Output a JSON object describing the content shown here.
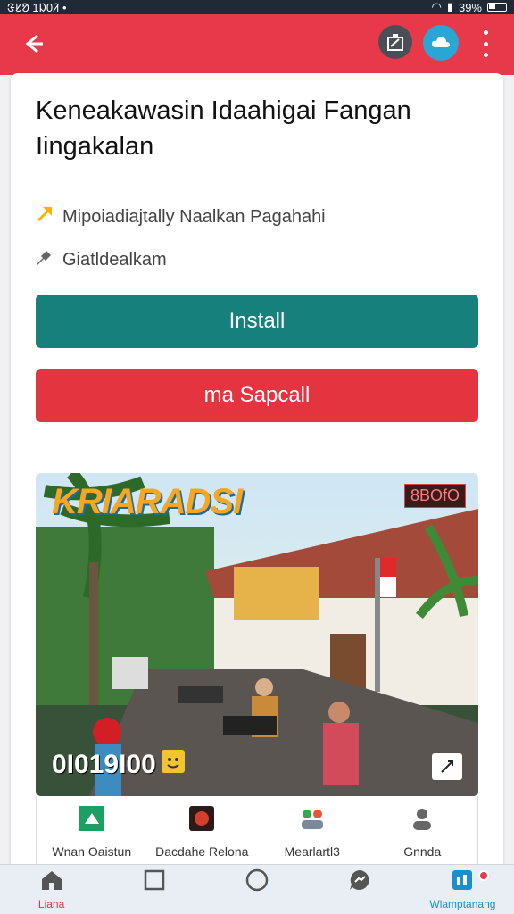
{
  "status_bar": {
    "time": "ᱝᱥᱚ 1ᱡ0ᱤ •",
    "battery": "39%"
  },
  "app_bar": {
    "back_icon": "arrow-left-icon",
    "icons": [
      "share-icon",
      "cloud-icon",
      "more-vertical-icon"
    ]
  },
  "content": {
    "title": "Keneakawasin Idaahigai Fangan Iingakalan",
    "meta1": "Mipoiadiajtally Naalkan Pagahahi",
    "meta2": "Giatldealkam",
    "install_label": "Install",
    "secondary_label": "ma Sapcall",
    "image": {
      "badge_left": "KRIARADSI",
      "badge_right": "8BOfO",
      "counter": "0I019I00"
    }
  },
  "actions": [
    {
      "label": "Wnan Oaistun",
      "icon": "whatsapp-icon"
    },
    {
      "label": "Dacdahe Relona",
      "icon": "game-icon"
    },
    {
      "label": "Mearlartl3",
      "icon": "people-icon"
    },
    {
      "label": "Gnnda",
      "icon": "person-icon"
    }
  ],
  "bottom_nav": [
    {
      "label": "Liana",
      "icon": "home-icon"
    },
    {
      "label": "",
      "icon": "square-icon"
    },
    {
      "label": "",
      "icon": "circle-icon"
    },
    {
      "label": "",
      "icon": "chat-icon"
    },
    {
      "label": "Wlamptanang",
      "icon": "app-icon"
    }
  ],
  "colors": {
    "accent_red": "#e8394a",
    "install_teal": "#16807c",
    "nav_blue": "#1a8fd0"
  }
}
